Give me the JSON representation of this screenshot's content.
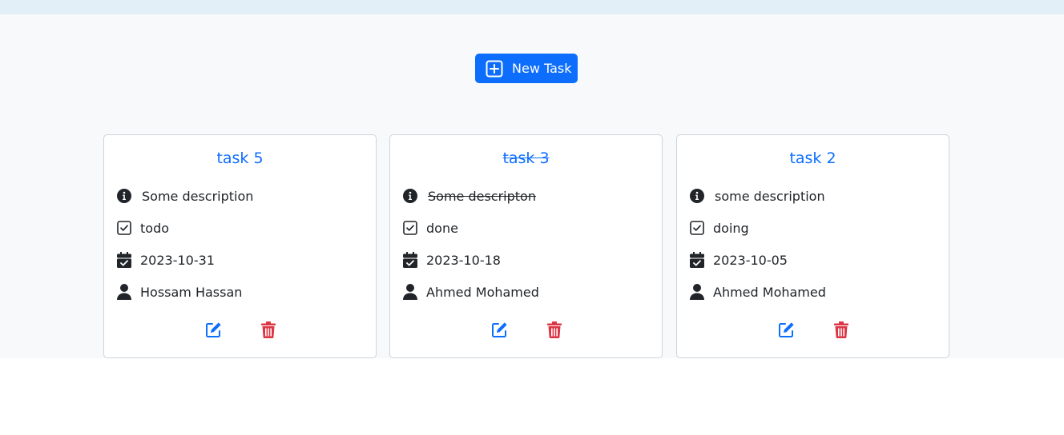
{
  "toolbar": {
    "new_task_label": "New Task",
    "new_task_icon": "plus-square-icon",
    "accent": "#0d6efd"
  },
  "tasks": [
    {
      "title": "task 5",
      "completed": false,
      "description": "Some description",
      "status": "todo",
      "due_date": "2023-10-31",
      "assignee": "Hossam Hassan"
    },
    {
      "title": "task 3",
      "completed": true,
      "description": "Some descripton",
      "status": "done",
      "due_date": "2023-10-18",
      "assignee": "Ahmed Mohamed"
    },
    {
      "title": "task 2",
      "completed": false,
      "description": "some description",
      "status": "doing",
      "due_date": "2023-10-05",
      "assignee": "Ahmed Mohamed"
    }
  ],
  "icons": {
    "description": "info-circle-icon",
    "status": "check-square-icon",
    "due_date": "calendar-check-icon",
    "assignee": "person-icon",
    "edit": "edit-icon",
    "delete": "trash-icon"
  },
  "colors": {
    "title": "#0d6efd",
    "edit": "#0d6efd",
    "delete": "#dc3545",
    "page_bg": "#f8f9fa",
    "top_bar": "#e2eff6"
  }
}
